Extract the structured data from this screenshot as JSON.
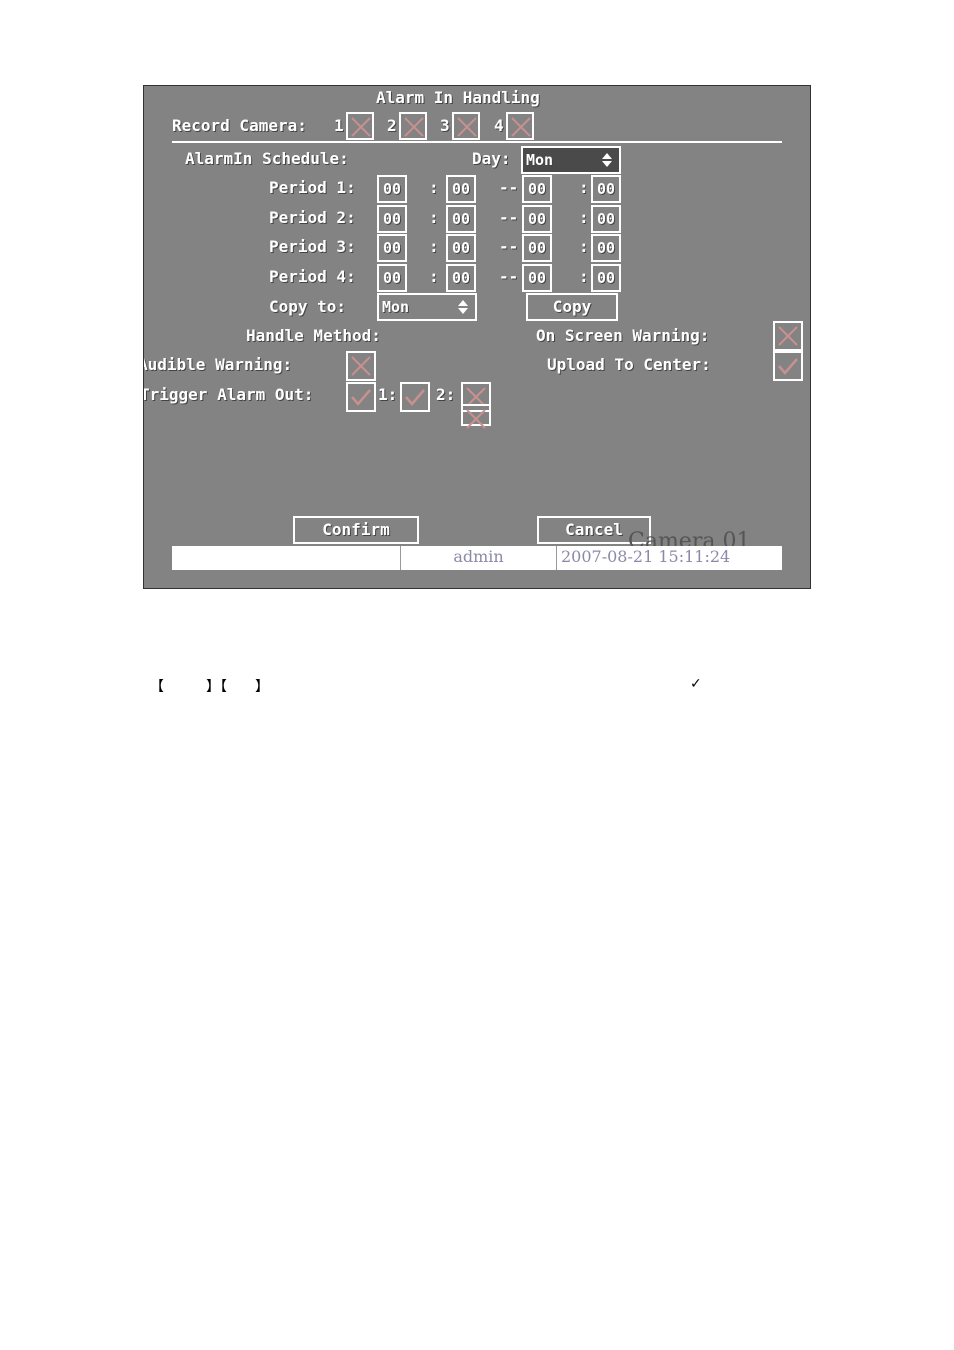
{
  "dialog": {
    "title": "Alarm In Handling",
    "record_camera_label": "Record Camera:",
    "record_camera_channels": [
      "1",
      "2",
      "3",
      "4"
    ],
    "schedule_label": "AlarmIn Schedule:",
    "day_label": "Day:",
    "day_value": "Mon",
    "periods": [
      {
        "label": "Period 1:",
        "start_h": "00",
        "start_m": "00",
        "end_h": "00",
        "end_m": "00"
      },
      {
        "label": "Period 2:",
        "start_h": "00",
        "start_m": "00",
        "end_h": "00",
        "end_m": "00"
      },
      {
        "label": "Period 3:",
        "start_h": "00",
        "start_m": "00",
        "end_h": "00",
        "end_m": "00"
      },
      {
        "label": "Period 4:",
        "start_h": "00",
        "start_m": "00",
        "end_h": "00",
        "end_m": "00"
      }
    ],
    "colon": ":",
    "dash": "--",
    "copy_to_label": "Copy to:",
    "copy_to_value": "Mon",
    "copy_button": "Copy",
    "handle_method_label": "Handle Method:",
    "on_screen_warning_label": "On Screen Warning:",
    "audible_warning_label": "Audible Warning:",
    "upload_to_center_label": "Upload To Center:",
    "trigger_alarm_out_label": "Trigger Alarm Out:",
    "alarm_out_channels": [
      "1:",
      "2:"
    ],
    "confirm_button": "Confirm",
    "cancel_button": "Cancel",
    "camera_overlay": "Camera 01"
  },
  "status_bar": {
    "user": "admin",
    "datetime": "2007-08-21 15:11:24"
  },
  "below_text": {
    "bracket_1": "【　　　】【　　】",
    "checkmark": "✓"
  },
  "colors": {
    "screen_bg": "#838383",
    "text": "#ffffff",
    "checkbox_mark": "#c99090"
  }
}
